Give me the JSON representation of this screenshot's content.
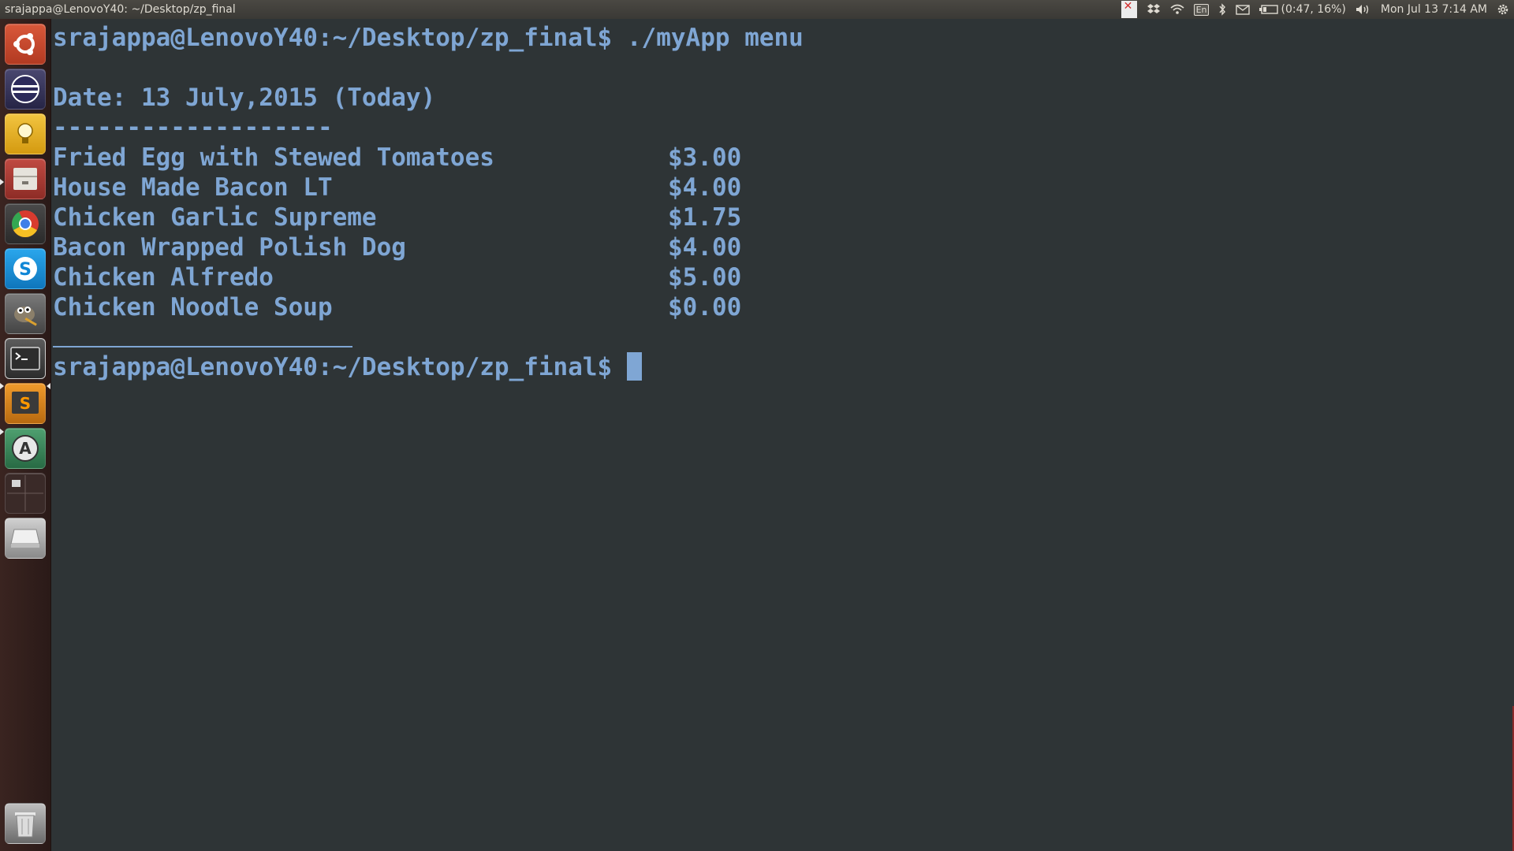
{
  "panel": {
    "window_title": "srajappa@LenovoY40: ~/Desktop/zp_final",
    "keyboard_layout": "En",
    "battery_text": "(0:47, 16%)",
    "clock": "Mon Jul 13  7:14 AM"
  },
  "launcher": {
    "items": [
      {
        "name": "dash-home",
        "icon": "ubuntu-logo-icon",
        "color": "#c9482c"
      },
      {
        "name": "eclipse",
        "icon": "eclipse-icon",
        "color": "#2c2a5a"
      },
      {
        "name": "keepnote",
        "icon": "lightbulb-icon",
        "color": "#e2a81c"
      },
      {
        "name": "files",
        "icon": "file-cabinet-icon",
        "color": "#b0423a"
      },
      {
        "name": "chrome",
        "icon": "chrome-icon",
        "color": "#3a3a3a"
      },
      {
        "name": "skype",
        "icon": "skype-icon",
        "color": "#1d8fd6"
      },
      {
        "name": "gimp",
        "icon": "gimp-icon",
        "color": "#6a6a6a"
      },
      {
        "name": "terminal",
        "icon": "terminal-icon",
        "color": "#2c2c2c"
      },
      {
        "name": "sublime-text",
        "icon": "sublime-text-icon",
        "color": "#4a4a4a"
      },
      {
        "name": "software-updater",
        "icon": "software-updater-icon",
        "color": "#3d8a5a"
      },
      {
        "name": "workspace-switcher",
        "icon": "workspaces-icon",
        "color": "#3a2a28"
      },
      {
        "name": "disk",
        "icon": "drive-icon",
        "color": "#9a9a9a"
      },
      {
        "name": "trash",
        "icon": "trash-icon",
        "color": "#7a7a7a"
      }
    ]
  },
  "terminal": {
    "prompt": "srajappa@LenovoY40:~/Desktop/zp_final$",
    "command": " ./myApp menu",
    "date_line": "Date: 13 July,2015 (Today)",
    "separator": "-------------------",
    "menu_items": [
      {
        "name": "Fried Egg with Stewed Tomatoes",
        "price": "$3.00"
      },
      {
        "name": "House Made Bacon LT",
        "price": "$4.00"
      },
      {
        "name": "Chicken Garlic Supreme",
        "price": "$1.75"
      },
      {
        "name": "Bacon Wrapped Polish Dog",
        "price": "$4.00"
      },
      {
        "name": "Chicken Alfredo",
        "price": "$5.00"
      },
      {
        "name": "Chicken Noodle Soup",
        "price": "$0.00"
      }
    ],
    "second_prompt": "srajappa@LenovoY40:~/Desktop/zp_final$ ",
    "text_color": "#7fa6d4",
    "background": "#2e3436"
  }
}
